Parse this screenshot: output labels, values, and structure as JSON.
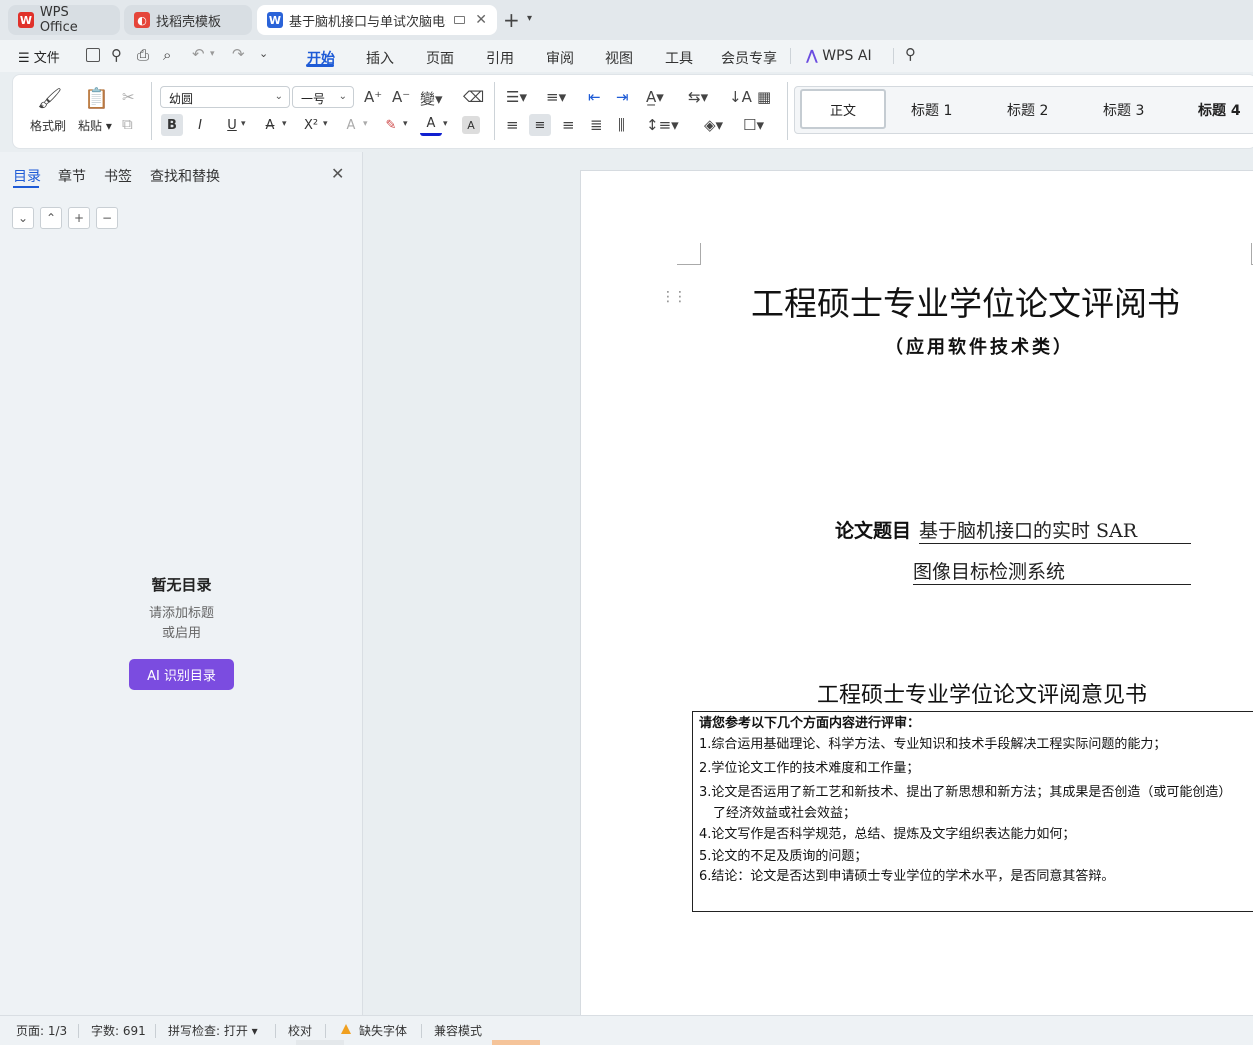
{
  "tabs": [
    {
      "label": "WPS Office",
      "icon": "wps-logo-icon"
    },
    {
      "label": "找稻壳模板",
      "icon": "docer-icon"
    },
    {
      "label": "基于脑机接口与单试次脑电分",
      "icon": "word-doc-icon"
    }
  ],
  "menubar": {
    "file": "文件",
    "items": [
      "开始",
      "插入",
      "页面",
      "引用",
      "审阅",
      "视图",
      "工具",
      "会员专享"
    ],
    "active": "开始",
    "wps_ai": "WPS AI"
  },
  "ribbon": {
    "format_painter": "格式刷",
    "paste": "粘贴",
    "font_name": "幼圆",
    "font_size": "一号",
    "styles": [
      "正文",
      "标题 1",
      "标题 2",
      "标题 3",
      "标题 4"
    ]
  },
  "panel": {
    "tabs": [
      "目录",
      "章节",
      "书签",
      "查找和替换"
    ],
    "empty_title": "暂无目录",
    "empty_line1": "请添加标题",
    "empty_line2": "或启用",
    "ai_button": "AI 识别目录"
  },
  "document": {
    "title": "工程硕士专业学位论文评阅书",
    "subtitle": "（应用软件技术类）",
    "topic_label": "论文题目",
    "topic_line1": "基于脑机接口的实时 SAR",
    "topic_line2": "图像目标检测系统",
    "heading2": "工程硕士专业学位论文评阅意见书",
    "box_intro": "请您参考以下几个方面内容进行评审：",
    "box_items": [
      "1.综合运用基础理论、科学方法、专业知识和技术手段解决工程实际问题的能力；",
      "2.学位论文工作的技术难度和工作量；",
      "3.论文是否运用了新工艺和新技术、提出了新思想和新方法；其成果是否创造（或可能创造）",
      "了经济效益或社会效益；",
      "4.论文写作是否科学规范，总结、提炼及文字组织表达能力如何；",
      "5.论文的不足及质询的问题；",
      "6.结论：论文是否达到申请硕士专业学位的学术水平，是否同意其答辩。"
    ]
  },
  "status": {
    "page": "页面: 1/3",
    "words": "字数: 691",
    "spell": "拼写检查: 打开",
    "proof": "校对",
    "missing_font": "缺失字体",
    "compat": "兼容模式"
  },
  "colors": {
    "accent": "#1e5bd6",
    "ai_purple": "#7b4ce0",
    "wps_red": "#e0312a"
  }
}
